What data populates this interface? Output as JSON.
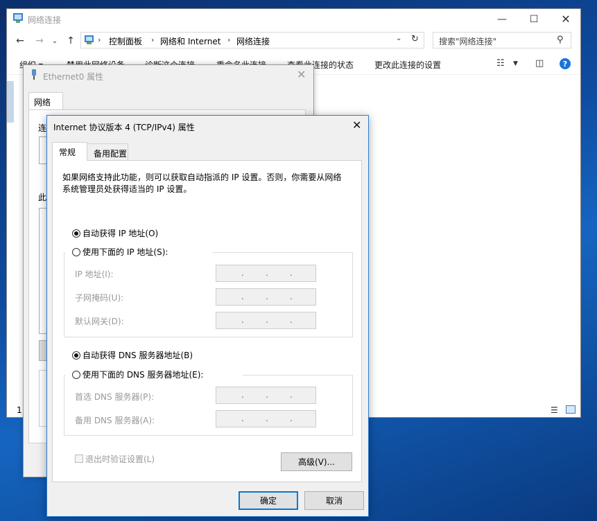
{
  "explorer": {
    "title": "网络连接",
    "breadcrumbs": [
      "控制面板",
      "网络和 Internet",
      "网络连接"
    ],
    "search_placeholder": "搜索\"网络连接\"",
    "commands": [
      "组织 ▾",
      "禁用此网络设备",
      "诊断这个连接",
      "重命名此连接",
      "查看此连接的状态",
      "更改此连接的设置"
    ],
    "status_count": "1",
    "icons": {
      "back": "arrow-left-icon",
      "forward": "arrow-right-icon",
      "recent": "chevron-down-icon",
      "up": "arrow-up-icon",
      "refresh": "refresh-icon",
      "search": "search-icon",
      "help": "help-icon"
    }
  },
  "ethernet_dialog": {
    "title": "Ethernet0 属性",
    "tab": "网络",
    "label1": "连",
    "label2": "此"
  },
  "ipv4_dialog": {
    "title": "Internet 协议版本 4 (TCP/IPv4) 属性",
    "tabs": [
      "常规",
      "备用配置"
    ],
    "intro": "如果网络支持此功能，则可以获取自动指派的 IP 设置。否则，你需要从网络系统管理员处获得适当的 IP 设置。",
    "ip_auto_label": "自动获得 IP 地址(O)",
    "ip_manual_label": "使用下面的 IP 地址(S):",
    "ip_fields": [
      "IP 地址(I):",
      "子网掩码(U):",
      "默认网关(D):"
    ],
    "dns_auto_label": "自动获得 DNS 服务器地址(B)",
    "dns_manual_label": "使用下面的 DNS 服务器地址(E):",
    "dns_fields": [
      "首选 DNS 服务器(P):",
      "备用 DNS 服务器(A):"
    ],
    "ip_auto_selected": true,
    "dns_auto_selected": true,
    "validate_label": "退出时验证设置(L)",
    "validate_checked": false,
    "advanced_label": "高级(V)...",
    "ok_label": "确定",
    "cancel_label": "取消"
  }
}
